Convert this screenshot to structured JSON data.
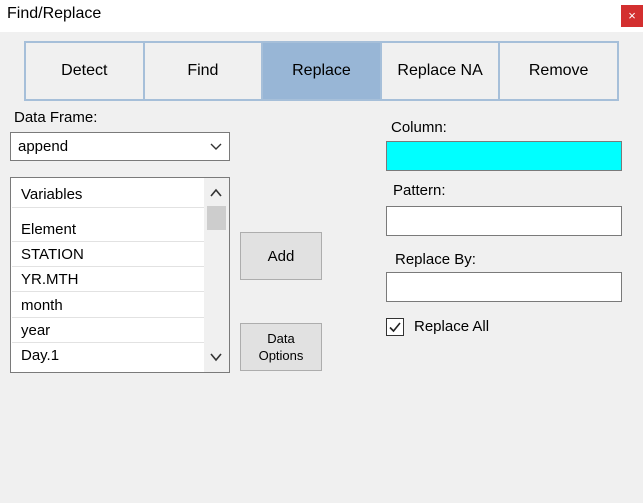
{
  "window": {
    "title": "Find/Replace",
    "close_glyph": "×"
  },
  "tabs": [
    {
      "label": "Detect",
      "active": false
    },
    {
      "label": "Find",
      "active": false
    },
    {
      "label": "Replace",
      "active": true
    },
    {
      "label": "Replace NA",
      "active": false
    },
    {
      "label": "Remove",
      "active": false
    }
  ],
  "data_frame": {
    "label": "Data Frame:",
    "value": "append"
  },
  "variables": {
    "header": "Variables",
    "items": [
      "Element",
      "STATION",
      "YR.MTH",
      "month",
      "year",
      "Day.1"
    ]
  },
  "buttons": {
    "add": "Add",
    "data_options": "Data\nOptions"
  },
  "column": {
    "label": "Column:",
    "value": "",
    "fill_color": "#00ffff"
  },
  "pattern": {
    "label": "Pattern:",
    "value": ""
  },
  "replace_by": {
    "label": "Replace By:",
    "value": ""
  },
  "replace_all": {
    "label": "Replace All",
    "checked": true
  },
  "colors": {
    "active_tab": "#98b6d6",
    "tab_border": "#a6bfd9",
    "close_button": "#d32f2f"
  }
}
